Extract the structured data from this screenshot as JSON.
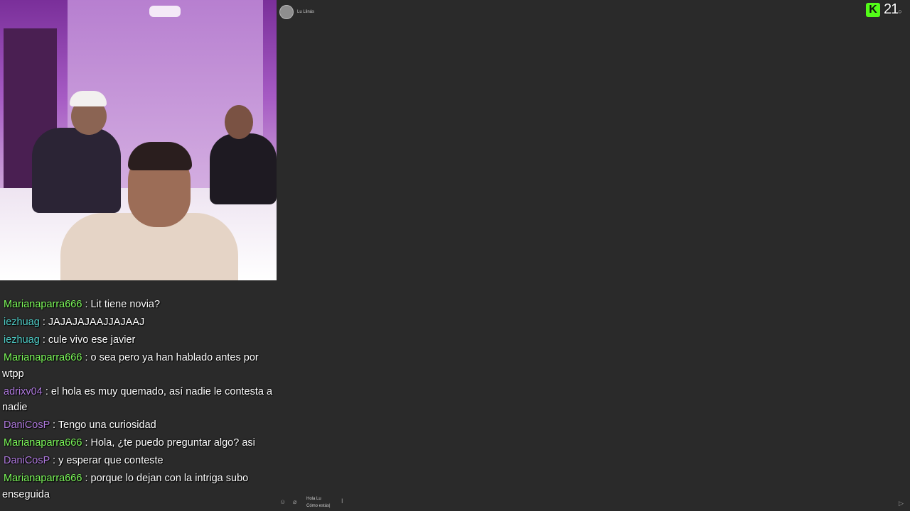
{
  "dm": {
    "contact_name": "Lu Llinás",
    "composer_lines": [
      "Hola Lu",
      "Cómo estás|"
    ]
  },
  "stream": {
    "viewer_count": "21",
    "viewer_suffix": "○"
  },
  "chat": {
    "messages": [
      {
        "user": "Marianaparra666",
        "text": " : Lit tiene novia?"
      },
      {
        "user": "iezhuag",
        "text": " : JAJAJAJAAJJAJAAJ"
      },
      {
        "user": "iezhuag",
        "text": " : cule vivo ese javier"
      },
      {
        "user": "Marianaparra666",
        "text": " : o sea pero ya han hablado antes por wtpp"
      },
      {
        "user": "adrixv04",
        "text": " : el hola es muy quemado, así nadie le contesta a nadie"
      },
      {
        "user": "DaniCosP",
        "text": " : Tengo una curiosidad"
      },
      {
        "user": "Marianaparra666",
        "text": " : Hola, ¿te puedo preguntar algo? asi"
      },
      {
        "user": "DaniCosP",
        "text": " : y esperar que conteste"
      },
      {
        "user": "Marianaparra666",
        "text": " : porque lo dejan con la intriga subo enseguida"
      }
    ]
  },
  "colors": {
    "user_green": "#7dfa5b",
    "user_teal": "#4ecbc5",
    "user_purple": "#b17be0",
    "kick_green": "#53fc18"
  }
}
